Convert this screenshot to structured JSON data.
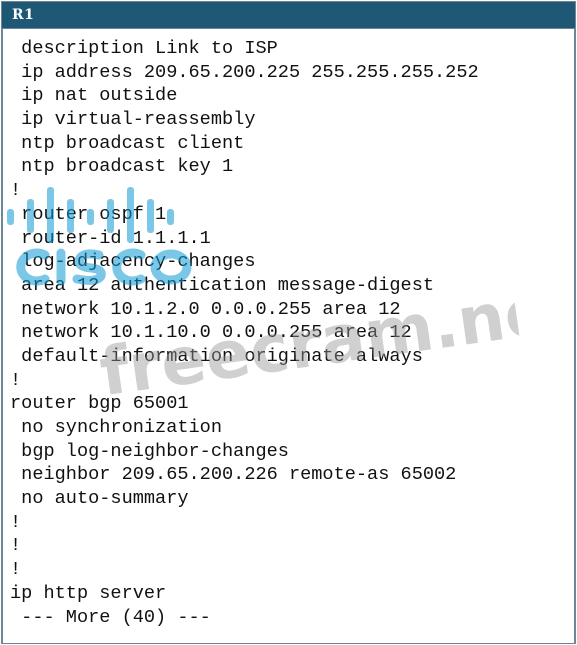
{
  "window": {
    "title": "R1"
  },
  "terminal": {
    "lines": [
      " description Link to ISP",
      " ip address 209.65.200.225 255.255.255.252",
      " ip nat outside",
      " ip virtual-reassembly",
      " ntp broadcast client",
      " ntp broadcast key 1",
      "!",
      " router ospf 1",
      " router-id 1.1.1.1",
      " log-adjacency-changes",
      " area 12 authentication message-digest",
      " network 10.1.2.0 0.0.0.255 area 12",
      " network 10.1.10.0 0.0.0.255 area 12",
      " default-information originate always",
      "!",
      "router bgp 65001",
      " no synchronization",
      " bgp log-neighbor-changes",
      " neighbor 209.65.200.226 remote-as 65002",
      " no auto-summary",
      "!",
      "!",
      "!",
      "ip http server",
      " --- More (40) ---"
    ]
  },
  "watermark": {
    "logo_word": "cisco",
    "site_text": "freecram.net",
    "color": "#0f9bd7"
  }
}
